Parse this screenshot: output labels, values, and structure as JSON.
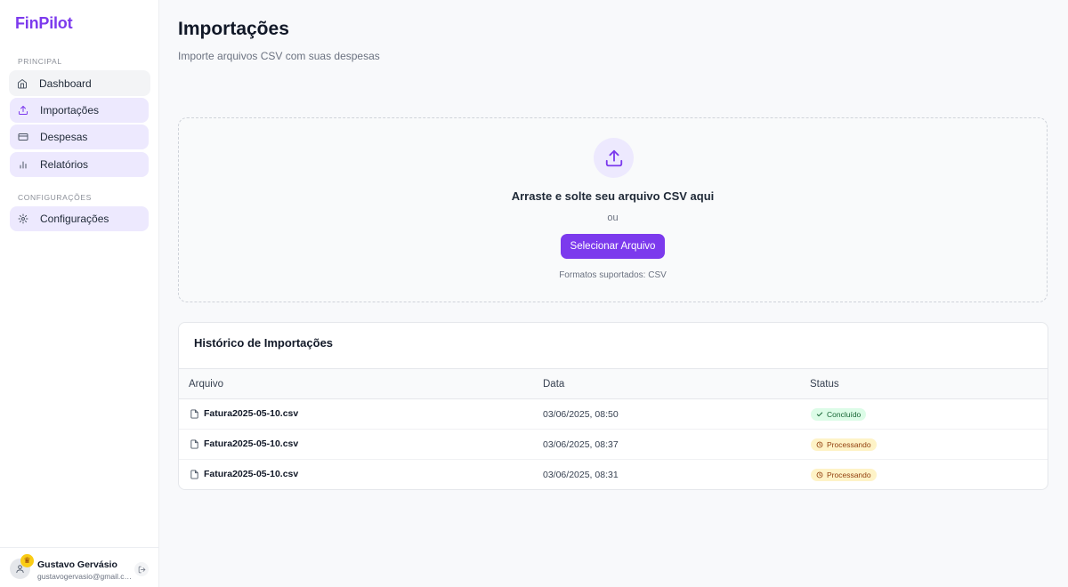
{
  "brand": "FinPilot",
  "sidebar": {
    "section_principal": "PRINCIPAL",
    "section_config": "CONFIGURAÇÕES",
    "items": [
      {
        "label": "Dashboard",
        "icon": "home-icon"
      },
      {
        "label": "Importações",
        "icon": "upload-icon"
      },
      {
        "label": "Despesas",
        "icon": "credit-card-icon"
      },
      {
        "label": "Relatórios",
        "icon": "bar-chart-icon"
      },
      {
        "label": "Configurações",
        "icon": "gear-icon"
      }
    ]
  },
  "user": {
    "name": "Gustavo Gervásio",
    "email": "gustavogervasio@gmail.com",
    "badge_icon": "crown-icon"
  },
  "header": {
    "title": "Importações",
    "subtitle": "Importe arquivos CSV com suas despesas"
  },
  "dropzone": {
    "title": "Arraste e solte seu arquivo CSV aqui",
    "or": "ou",
    "button": "Selecionar Arquivo",
    "formats": "Formatos suportados: CSV"
  },
  "history": {
    "title": "Histórico de Importações",
    "columns": [
      "Arquivo",
      "Data",
      "Status"
    ],
    "rows": [
      {
        "file": "Fatura2025-05-10.csv",
        "date": "03/06/2025, 08:50",
        "status": "Concluído"
      },
      {
        "file": "Fatura2025-05-10.csv",
        "date": "03/06/2025, 08:37",
        "status": "Processando"
      },
      {
        "file": "Fatura2025-05-10.csv",
        "date": "03/06/2025, 08:31",
        "status": "Processando"
      }
    ]
  },
  "colors": {
    "accent": "#7c3aed",
    "accent_soft": "#ede9fe",
    "success_bg": "#dcfce7",
    "warning_bg": "#fef3c7"
  }
}
